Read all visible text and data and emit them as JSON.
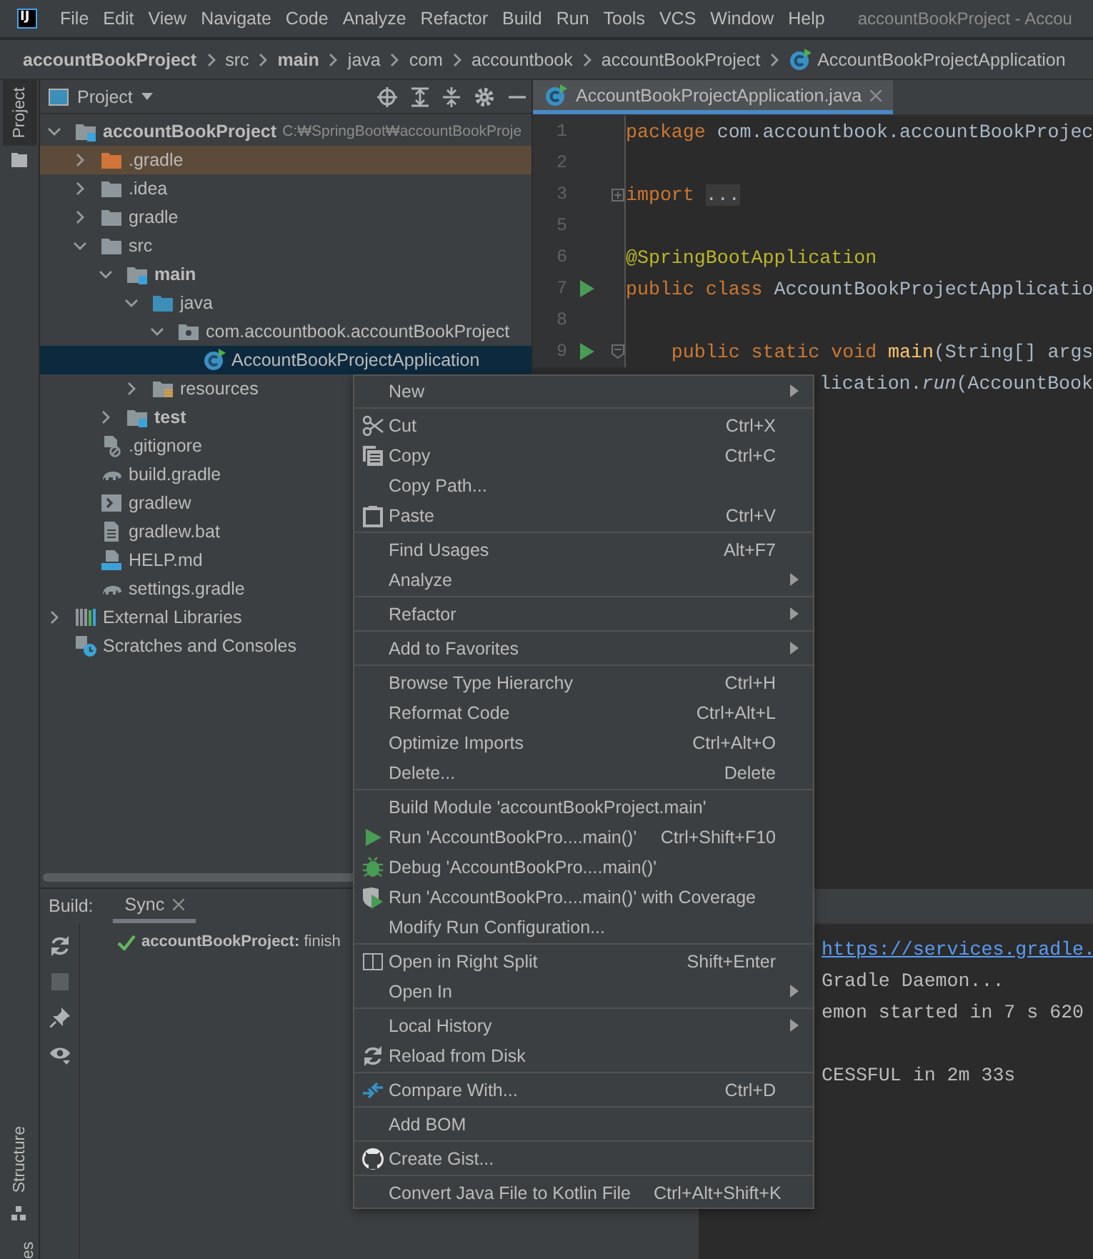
{
  "menu_bar": {
    "logo": "IJ",
    "items": [
      "File",
      "Edit",
      "View",
      "Navigate",
      "Code",
      "Analyze",
      "Refactor",
      "Build",
      "Run",
      "Tools",
      "VCS",
      "Window",
      "Help"
    ],
    "title": "accountBookProject - Accou"
  },
  "breadcrumbs": [
    {
      "label": "accountBookProject",
      "bold": true,
      "kind": "folder"
    },
    {
      "label": "src",
      "bold": false,
      "kind": "folder"
    },
    {
      "label": "main",
      "bold": true,
      "kind": "folder"
    },
    {
      "label": "java",
      "bold": false,
      "kind": "folder"
    },
    {
      "label": "com",
      "bold": false,
      "kind": "folder"
    },
    {
      "label": "accountbook",
      "bold": false,
      "kind": "folder"
    },
    {
      "label": "accountBookProject",
      "bold": false,
      "kind": "folder"
    },
    {
      "label": "AccountBookProjectApplication",
      "bold": false,
      "kind": "class"
    }
  ],
  "tool_stripe": {
    "tabs": [
      {
        "label": "Project",
        "selected": true
      },
      {
        "label": "Structure",
        "selected": false
      },
      {
        "label": "es",
        "selected": false
      }
    ]
  },
  "project_panel": {
    "title": "Project",
    "tree": [
      {
        "label": "accountBookProject",
        "hint": "C:₩SpringBoot₩accountBookProje",
        "kind": "module",
        "bold": true,
        "expanded": true,
        "selected": false,
        "children": [
          {
            "label": ".gradle",
            "kind": "excluded",
            "expanded": false,
            "selected": false,
            "excluded": true
          },
          {
            "label": ".idea",
            "kind": "folder",
            "expanded": false,
            "selected": false
          },
          {
            "label": "gradle",
            "kind": "folder",
            "expanded": false,
            "selected": false
          },
          {
            "label": "src",
            "kind": "folder",
            "expanded": true,
            "selected": false,
            "children": [
              {
                "label": "main",
                "kind": "module",
                "bold": true,
                "expanded": true,
                "selected": false,
                "children": [
                  {
                    "label": "java",
                    "kind": "source",
                    "expanded": true,
                    "selected": false,
                    "children": [
                      {
                        "label": "com.accountbook.accountBookProject",
                        "kind": "package",
                        "expanded": true,
                        "selected": false,
                        "children": [
                          {
                            "label": "AccountBookProjectApplication",
                            "kind": "class",
                            "selected": true
                          }
                        ]
                      }
                    ]
                  },
                  {
                    "label": "resources",
                    "kind": "resources",
                    "expanded": false,
                    "selected": false
                  }
                ]
              },
              {
                "label": "test",
                "kind": "module",
                "bold": true,
                "expanded": false,
                "selected": false
              }
            ]
          },
          {
            "label": ".gitignore",
            "kind": "ignore",
            "selected": false
          },
          {
            "label": "build.gradle",
            "kind": "gradle",
            "selected": false
          },
          {
            "label": "gradlew",
            "kind": "terminal",
            "selected": false
          },
          {
            "label": "gradlew.bat",
            "kind": "text",
            "selected": false
          },
          {
            "label": "HELP.md",
            "kind": "markdown",
            "selected": false
          },
          {
            "label": "settings.gradle",
            "kind": "gradle",
            "selected": false
          }
        ]
      },
      {
        "label": "External Libraries",
        "kind": "libraries",
        "expanded": false,
        "selected": false
      },
      {
        "label": "Scratches and Consoles",
        "kind": "scratches",
        "selected": false
      }
    ]
  },
  "editor": {
    "tab": {
      "label": "AccountBookProjectApplication.java",
      "selected": true
    },
    "lines": [
      {
        "number": "1",
        "run": false,
        "code": [
          {
            "kind": "keyword",
            "text": "package"
          },
          {
            "kind": "plain",
            "text": " com.accountbook.accountBookProjec"
          }
        ]
      },
      {
        "number": "2",
        "run": false
      },
      {
        "number": "3",
        "run": false,
        "collapsed": true,
        "code": [
          {
            "kind": "keyword",
            "text": "import "
          },
          {
            "kind": "folded",
            "text": "..."
          }
        ]
      },
      {
        "number": "5",
        "run": false
      },
      {
        "number": "6",
        "run": false,
        "code": [
          {
            "kind": "annotation",
            "text": "@SpringBootApplication"
          }
        ]
      },
      {
        "number": "7",
        "run": true,
        "code": [
          {
            "kind": "keyword",
            "text": "public class"
          },
          {
            "kind": "plain",
            "text": " AccountBookProjectApplicatio"
          }
        ]
      },
      {
        "number": "8",
        "run": false
      },
      {
        "number": "9",
        "run": true,
        "collapsed": false,
        "code": [
          {
            "kind": "keyword",
            "text": "    public static void "
          },
          {
            "kind": "method",
            "text": "main"
          },
          {
            "kind": "plain",
            "text": "(String[] args"
          }
        ]
      },
      {
        "partial": true,
        "code": [
          {
            "kind": "plain",
            "text": "lication."
          },
          {
            "kind": "static",
            "text": "run"
          },
          {
            "kind": "plain",
            "text": "(AccountBook"
          }
        ]
      }
    ]
  },
  "build_panel": {
    "label": "Build:",
    "tabs": [
      {
        "label": "Sync",
        "selected": true,
        "closable": true
      }
    ],
    "tree": [
      {
        "done": true,
        "text": "**accountBookProject:** finish"
      }
    ],
    "console": [
      {
        "kind": "link",
        "text": "https://services.gradle."
      },
      {
        "kind": "plain",
        "text": "Gradle Daemon..."
      },
      {
        "kind": "plain",
        "text": "emon started in 7 s 620"
      },
      {
        "kind": "blank"
      },
      {
        "kind": "plain",
        "text": "CESSFUL in 2m 33s"
      }
    ]
  },
  "context_menu": {
    "items": [
      {
        "kind": "plain",
        "label": "New",
        "submenu": true
      },
      {
        "kind": "separator"
      },
      {
        "kind": "cut",
        "label": "Cut",
        "shortcut": "Ctrl+X",
        "submenu": false
      },
      {
        "kind": "copy",
        "label": "Copy",
        "shortcut": "Ctrl+C",
        "submenu": false
      },
      {
        "kind": "plain",
        "label": "Copy Path...",
        "submenu": false
      },
      {
        "kind": "paste",
        "label": "Paste",
        "shortcut": "Ctrl+V",
        "submenu": false
      },
      {
        "kind": "separator"
      },
      {
        "kind": "plain",
        "label": "Find Usages",
        "shortcut": "Alt+F7",
        "submenu": false
      },
      {
        "kind": "plain",
        "label": "Analyze",
        "submenu": true
      },
      {
        "kind": "separator"
      },
      {
        "kind": "plain",
        "label": "Refactor",
        "submenu": true
      },
      {
        "kind": "separator"
      },
      {
        "kind": "plain",
        "label": "Add to Favorites",
        "submenu": true
      },
      {
        "kind": "separator"
      },
      {
        "kind": "plain",
        "label": "Browse Type Hierarchy",
        "shortcut": "Ctrl+H",
        "submenu": false
      },
      {
        "kind": "plain",
        "label": "Reformat Code",
        "shortcut": "Ctrl+Alt+L",
        "submenu": false
      },
      {
        "kind": "plain",
        "label": "Optimize Imports",
        "shortcut": "Ctrl+Alt+O",
        "submenu": false
      },
      {
        "kind": "plain",
        "label": "Delete...",
        "shortcut": "Delete",
        "submenu": false
      },
      {
        "kind": "separator"
      },
      {
        "kind": "plain",
        "label": "Build Module 'accountBookProject.main'",
        "submenu": false
      },
      {
        "kind": "run",
        "label": "Run 'AccountBookPro....main()'",
        "shortcut": "Ctrl+Shift+F10",
        "submenu": false
      },
      {
        "kind": "debug",
        "label": "Debug 'AccountBookPro....main()'",
        "submenu": false
      },
      {
        "kind": "coverage",
        "label": "Run 'AccountBookPro....main()' with Coverage",
        "submenu": false
      },
      {
        "kind": "plain",
        "label": "Modify Run Configuration...",
        "submenu": false
      },
      {
        "kind": "separator"
      },
      {
        "kind": "split",
        "label": "Open in Right Split",
        "shortcut": "Shift+Enter",
        "submenu": false
      },
      {
        "kind": "plain",
        "label": "Open In",
        "submenu": true
      },
      {
        "kind": "separator"
      },
      {
        "kind": "plain",
        "label": "Local History",
        "submenu": true
      },
      {
        "kind": "reload",
        "label": "Reload from Disk",
        "submenu": false
      },
      {
        "kind": "separator"
      },
      {
        "kind": "compare",
        "label": "Compare With...",
        "shortcut": "Ctrl+D",
        "submenu": false
      },
      {
        "kind": "separator"
      },
      {
        "kind": "plain",
        "label": "Add BOM",
        "submenu": false
      },
      {
        "kind": "separator"
      },
      {
        "kind": "github",
        "label": "Create Gist...",
        "submenu": false
      },
      {
        "kind": "separator"
      },
      {
        "kind": "plain",
        "label": "Convert Java File to Kotlin File",
        "shortcut": "Ctrl+Alt+Shift+K",
        "submenu": false
      }
    ]
  }
}
